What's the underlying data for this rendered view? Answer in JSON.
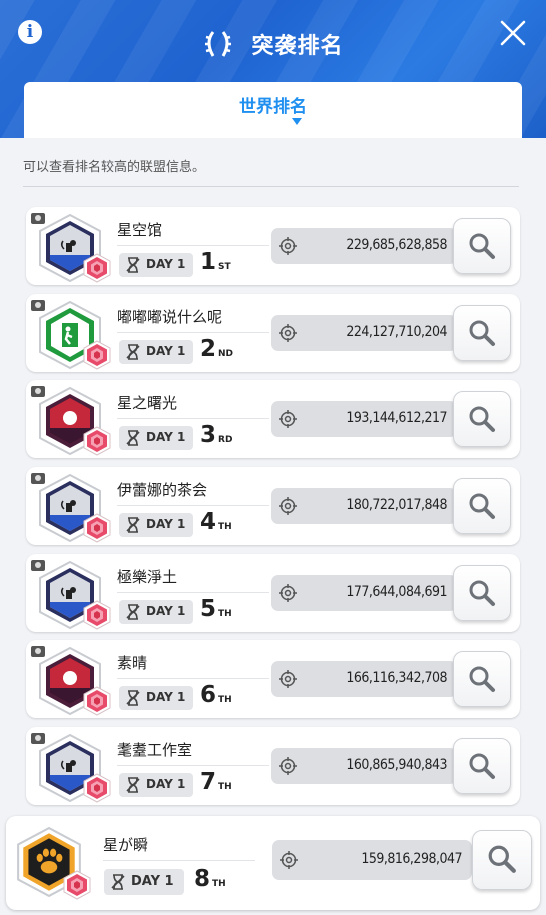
{
  "header": {
    "title": "突袭排名",
    "close_label": "×"
  },
  "tab": {
    "label": "世界排名"
  },
  "description": "可以查看排名较高的联盟信息。",
  "icons": {
    "info": "info-icon",
    "close": "close-icon",
    "laurel": "laurel-icon",
    "search": "search-icon",
    "target": "target-icon",
    "tag": "bookmark-icon",
    "clock": "hourglass-icon"
  },
  "colors": {
    "accent": "#1f8ff0",
    "header": "#1f63d0",
    "score_bg": "#dcdee2"
  },
  "rows": [
    {
      "name": "星空馆",
      "day": "DAY 1",
      "rank": "1",
      "suffix": "ST",
      "score": "229,685,628,858",
      "emblem": "cat-night"
    },
    {
      "name": "嘟嘟嘟说什么呢",
      "day": "DAY 1",
      "rank": "2",
      "suffix": "ND",
      "score": "224,127,710,204",
      "emblem": "exit-sign"
    },
    {
      "name": "星之曙光",
      "day": "DAY 1",
      "rank": "3",
      "suffix": "RD",
      "score": "193,144,612,217",
      "emblem": "red-moon"
    },
    {
      "name": "伊蕾娜的茶会",
      "day": "DAY 1",
      "rank": "4",
      "suffix": "TH",
      "score": "180,722,017,848",
      "emblem": "cat-night"
    },
    {
      "name": "極樂淨土",
      "day": "DAY 1",
      "rank": "5",
      "suffix": "TH",
      "score": "177,644,084,691",
      "emblem": "cat-night"
    },
    {
      "name": "素晴",
      "day": "DAY 1",
      "rank": "6",
      "suffix": "TH",
      "score": "166,116,342,708",
      "emblem": "red-moon"
    },
    {
      "name": "耄耋工作室",
      "day": "DAY 1",
      "rank": "7",
      "suffix": "TH",
      "score": "160,865,940,843",
      "emblem": "cat-night"
    },
    {
      "name": "星が瞬",
      "day": "DAY 1",
      "rank": "8",
      "suffix": "TH",
      "score": "159,816,298,047",
      "emblem": "paw"
    }
  ]
}
